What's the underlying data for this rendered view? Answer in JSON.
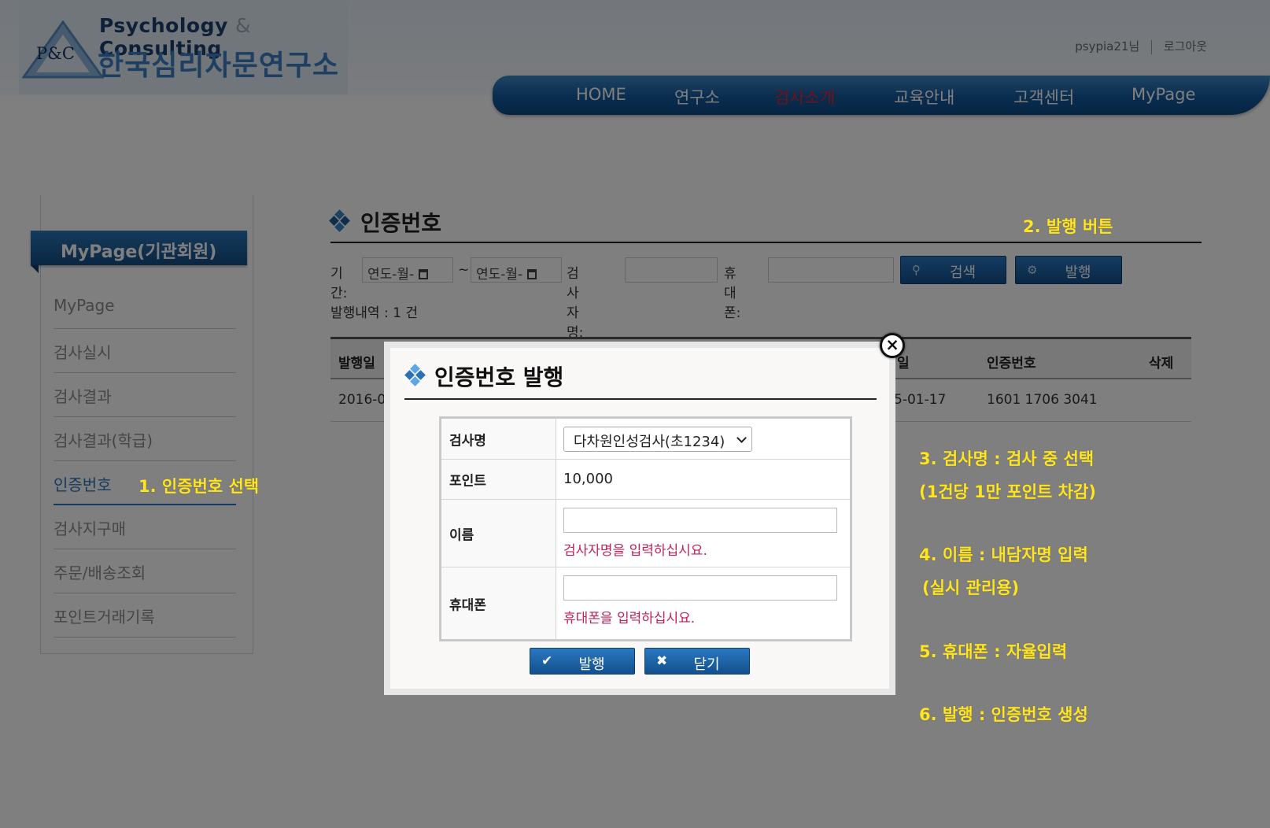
{
  "header": {
    "logo_en_left": "Psychology",
    "logo_en_amp": "&",
    "logo_en_right": "Consulting",
    "logo_ko": "한국심리자문연구소",
    "logo_mark": "P&C",
    "user_name": "psypia21님",
    "logout": "로그아웃"
  },
  "nav": {
    "items": [
      "HOME",
      "연구소",
      "검사소개",
      "교육안내",
      "고객센터",
      "MyPage"
    ],
    "active_index": 2,
    "active_color": "#e0223a"
  },
  "sidebar": {
    "title": "MyPage(기관회원)",
    "items": [
      "MyPage",
      "검사실시",
      "검사결과",
      "검사결과(학급)",
      "인증번호",
      "검사지구매",
      "주문/배송조회",
      "포인트거래기록"
    ],
    "active_index": 4
  },
  "main": {
    "title": "인증번호",
    "filter": {
      "period_label": "기간:",
      "date_from_placeholder": "연도-월-",
      "tilde": "~",
      "date_to_placeholder": "연도-월-",
      "name_label": "검사자명:",
      "phone_label": "휴대폰:",
      "search_button": "검색",
      "search_icon": "search-icon",
      "issue_button": "발행",
      "issue_icon": "gear-icon"
    },
    "count_text": "발행내역 : 1 건",
    "table": {
      "headers": [
        "발행일",
        "일",
        "인증번호",
        "삭제"
      ],
      "rows": [
        {
          "issue_date": "2016-0",
          "date_suffix": "5-01-17",
          "code": "1601 1706 3041"
        }
      ]
    }
  },
  "modal": {
    "title": "인증번호 발행",
    "test_name_label": "검사명",
    "test_name_value": "다차원인성검사(초1234)",
    "point_label": "포인트",
    "point_value": "10,000",
    "name_label": "이름",
    "name_hint": "검사자명을 입력하십시요.",
    "phone_label": "휴대폰",
    "phone_hint": "휴대폰을 입력하십시요.",
    "issue_button": "발행",
    "close_button": "닫기",
    "close_x": "×"
  },
  "annotations": {
    "step1": "1. 인증번호 선택",
    "step2": "2. 발행 버튼",
    "step3_a": "3. 검사명 : 검사 중 선택",
    "step3_b": "(1건당 1만 포인트 차감)",
    "step4_a": "4. 이름 : 내담자명 입력",
    "step4_b": "(실시 관리용)",
    "step5": "5. 휴대폰 : 자율입력",
    "step6": "6. 발행 : 인증번호 생성"
  },
  "colors": {
    "accent_blue": "#1c5d9d",
    "annotation_yellow": "#ffe51f",
    "hint_red": "#c0215a"
  }
}
